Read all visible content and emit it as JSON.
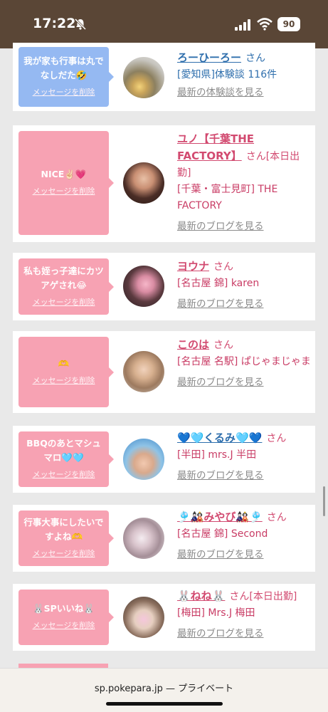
{
  "status": {
    "time": "17:22",
    "battery": "90"
  },
  "browser": {
    "url": "sp.pokepara.jp — プライベート"
  },
  "colors": {
    "pink_bubble": "#f7a2b3",
    "blue_bubble": "#95b9f2",
    "name_pink": "#d24a70",
    "name_blue": "#2f6fad"
  },
  "cards": [
    {
      "message": "我が家も行事は丸でなしだた🤣",
      "delete": "メッセージを削除",
      "name": "ろーひーろー",
      "san": "さん",
      "place": "[愛知県]体験談 116件",
      "more": "最新の体験談を見る"
    },
    {
      "message": "NICE✌🏻💗",
      "delete": "メッセージを削除",
      "name": "ユノ【千葉THE FACTORY】",
      "san": "さん[本日出勤]",
      "place": "[千葉・富士見町] THE FACTORY",
      "more": "最新のブログを見る"
    },
    {
      "message": "私も姪っ子達にカツアゲされ😂",
      "delete": "メッセージを削除",
      "name": "ヨウナ",
      "san": "さん",
      "place": "[名古屋 錦] karen",
      "more": "最新のブログを見る"
    },
    {
      "message": "🫶",
      "delete": "メッセージを削除",
      "name": "このは",
      "san": "さん",
      "place": "[名古屋 名駅] ぱじゃまじゃま",
      "more": "最新のブログを見る"
    },
    {
      "message": "BBQのあとマシュマロ🩵🩵",
      "delete": "メッセージを削除",
      "name": "💙🩵くるみ🩵💙",
      "san": "さん",
      "place": "[半田] mrs.J 半田",
      "more": "最新のブログを見る"
    },
    {
      "message": "行事大事にしたいですよね🫶",
      "delete": "メッセージを削除",
      "name": "🎐🎎みやび🎎🎐",
      "san": "さん",
      "place": "[名古屋 錦] Second",
      "more": "最新のブログを見る"
    },
    {
      "message": "🐰SPいいね🐰",
      "delete": "メッセージを削除",
      "name": "🐰ねね🐰",
      "san": "さん[本日出勤]",
      "place": "[梅田] Mrs.J 梅田",
      "more": "最新のブログを見る"
    }
  ]
}
